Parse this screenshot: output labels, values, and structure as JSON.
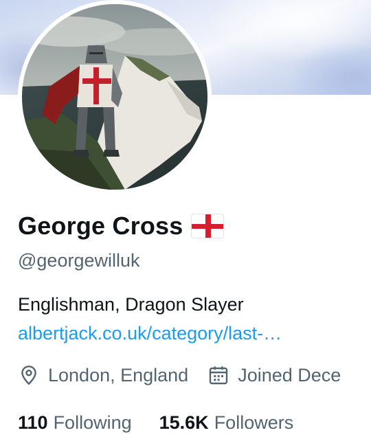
{
  "profile": {
    "display_name": "George Cross",
    "flag_icon": "england-flag-icon",
    "handle": "@georgewilluk",
    "bio": "Englishman, Dragon Slayer",
    "website": "albertjack.co.uk/category/last-…",
    "location": "London, England",
    "joined": "Joined Dece",
    "following_count": "110",
    "following_label": "Following",
    "followers_count": "15.6K",
    "followers_label": "Followers"
  },
  "colors": {
    "link": "#1d9bf0",
    "secondary_text": "#536471",
    "primary_text": "#0f1419",
    "flag_red": "#d2202f"
  },
  "icons": {
    "location": "location-pin-icon",
    "joined": "calendar-icon"
  }
}
